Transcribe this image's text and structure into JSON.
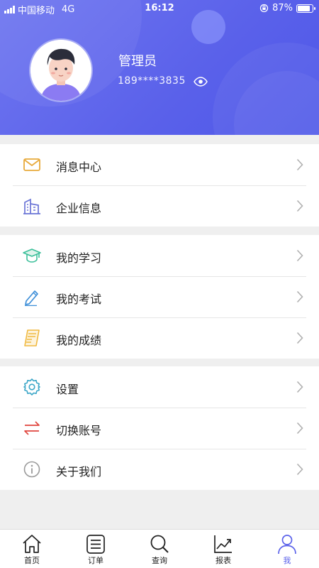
{
  "status_bar": {
    "carrier": "中国移动",
    "network": "4G",
    "time": "16:12",
    "battery": "87%",
    "battery_level": 0.87
  },
  "profile": {
    "name": "管理员",
    "phone": "189****3835"
  },
  "menu_groups": [
    [
      {
        "label": "消息中心",
        "icon": "mail-icon"
      },
      {
        "label": "企业信息",
        "icon": "building-icon"
      }
    ],
    [
      {
        "label": "我的学习",
        "icon": "graduation-cap-icon"
      },
      {
        "label": "我的考试",
        "icon": "pencil-icon"
      },
      {
        "label": "我的成绩",
        "icon": "scorecard-icon"
      }
    ],
    [
      {
        "label": "设置",
        "icon": "gear-icon"
      },
      {
        "label": "切换账号",
        "icon": "switch-arrows-icon"
      },
      {
        "label": "关于我们",
        "icon": "info-icon"
      }
    ]
  ],
  "tab_bar": {
    "tabs": [
      {
        "label": "首页",
        "icon": "home-icon"
      },
      {
        "label": "订单",
        "icon": "list-icon"
      },
      {
        "label": "查询",
        "icon": "search-icon"
      },
      {
        "label": "报表",
        "icon": "chart-icon"
      },
      {
        "label": "我",
        "icon": "user-icon"
      }
    ],
    "active_index": 4
  },
  "colors": {
    "header": "#5a61ea",
    "accent": "#5a61ea",
    "mail": "#e8a93a",
    "building": "#6a74d6",
    "cap": "#3bbf9a",
    "pencil": "#3e8fd8",
    "scorecard": "#f0b940",
    "gear": "#3da7c8",
    "switch": "#e0463e",
    "info": "#9a9a9a"
  }
}
